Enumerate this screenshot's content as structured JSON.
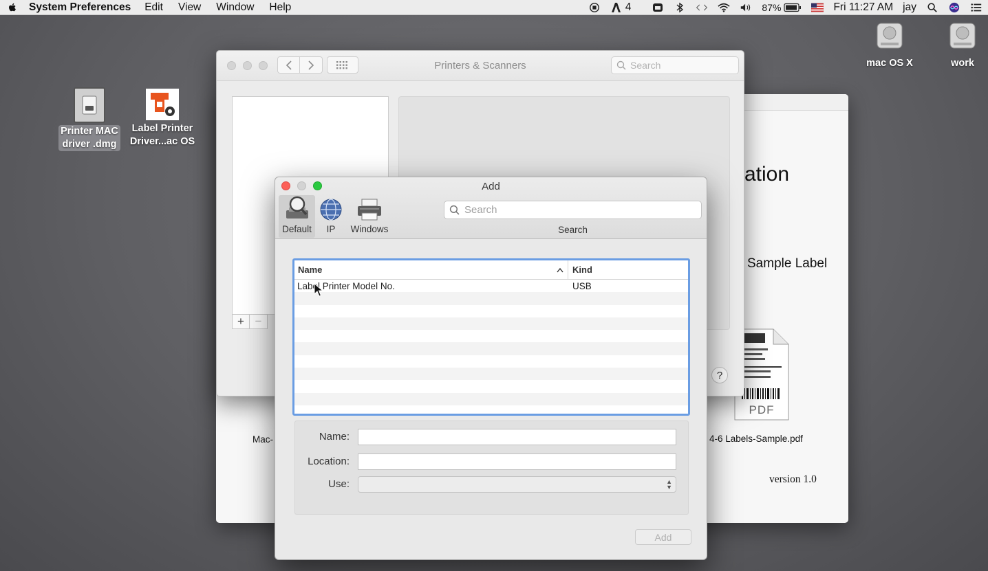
{
  "menubar": {
    "app_name": "System Preferences",
    "menus": [
      "Edit",
      "View",
      "Window",
      "Help"
    ],
    "status": {
      "adobe_count": "4",
      "battery": "87%",
      "clock": "Fri 11:27 AM",
      "user": "jay"
    }
  },
  "desktop": {
    "icons": [
      {
        "label_line1": "Printer MAC",
        "label_line2": "driver .dmg",
        "icon": "dmg-file-icon"
      },
      {
        "label_line1": "Label Printer",
        "label_line2": "Driver...ac OS",
        "icon": "label-printer-installer-icon"
      },
      {
        "label": "mac OS X",
        "icon": "hard-drive-icon"
      },
      {
        "label": "work",
        "icon": "hard-drive-icon"
      }
    ]
  },
  "installer": {
    "heading_fragment": "ation",
    "subheading_fragment": "Sample Label",
    "left_fragment": "Mac-",
    "pdf_badge": "PDF",
    "pdf_filename": "4-6 Labels-Sample.pdf",
    "version": "version 1.0"
  },
  "prefs": {
    "title": "Printers & Scanners",
    "search_placeholder": "Search",
    "add_label": "+",
    "remove_label": "−",
    "help_label": "?"
  },
  "add_dialog": {
    "title": "Add",
    "toolbar": [
      {
        "label": "Default",
        "selected": true,
        "icon": "default-printer-magnifier-icon"
      },
      {
        "label": "IP",
        "selected": false,
        "icon": "globe-icon"
      },
      {
        "label": "Windows",
        "selected": false,
        "icon": "windows-printer-icon"
      }
    ],
    "search_placeholder": "Search",
    "search_label": "Search",
    "table": {
      "columns": [
        "Name",
        "Kind"
      ],
      "rows": [
        {
          "name": "Label Printer Model No.",
          "kind": "USB"
        }
      ]
    },
    "form": {
      "name_label": "Name:",
      "location_label": "Location:",
      "use_label": "Use:",
      "name_value": "",
      "location_value": "",
      "use_value": ""
    },
    "add_button": "Add"
  },
  "colors": {
    "selection_border": "#6a9de3",
    "close": "#fc5f57",
    "zoom": "#2ac940"
  }
}
